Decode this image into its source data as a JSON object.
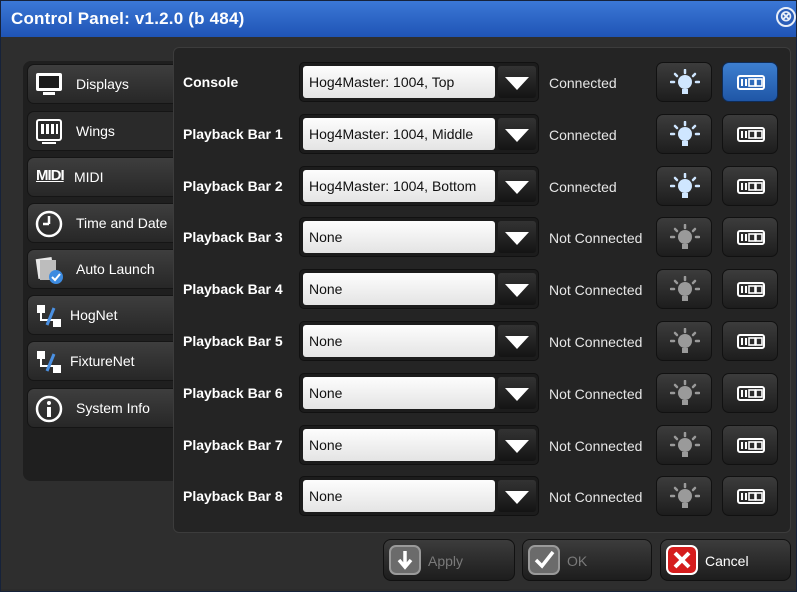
{
  "window": {
    "title": "Control Panel: v1.2.0 (b 484)",
    "close_glyph": "⊗"
  },
  "sidebar": {
    "items": [
      {
        "label": "Displays",
        "icon": "monitor-icon"
      },
      {
        "label": "Wings",
        "icon": "wing-icon"
      },
      {
        "label": "MIDI",
        "icon": "midi-icon"
      },
      {
        "label": "Time and Date",
        "icon": "clock-icon"
      },
      {
        "label": "Auto Launch",
        "icon": "auto-launch-icon"
      },
      {
        "label": "HogNet",
        "icon": "network-icon"
      },
      {
        "label": "FixtureNet",
        "icon": "network-icon"
      },
      {
        "label": "System Info",
        "icon": "info-icon"
      }
    ],
    "active": "Wings",
    "midi_logo": "MIDI"
  },
  "rows": [
    {
      "label": "Console",
      "value": "Hog4Master: 1004, Top",
      "status": "Connected",
      "bulb_on": true,
      "wing_selected": true
    },
    {
      "label": "Playback Bar 1",
      "value": "Hog4Master: 1004, Middle",
      "status": "Connected",
      "bulb_on": true,
      "wing_selected": false
    },
    {
      "label": "Playback Bar 2",
      "value": "Hog4Master: 1004, Bottom",
      "status": "Connected",
      "bulb_on": true,
      "wing_selected": false
    },
    {
      "label": "Playback Bar 3",
      "value": "None",
      "status": "Not Connected",
      "bulb_on": false,
      "wing_selected": false
    },
    {
      "label": "Playback Bar 4",
      "value": "None",
      "status": "Not Connected",
      "bulb_on": false,
      "wing_selected": false
    },
    {
      "label": "Playback Bar 5",
      "value": "None",
      "status": "Not Connected",
      "bulb_on": false,
      "wing_selected": false
    },
    {
      "label": "Playback Bar 6",
      "value": "None",
      "status": "Not Connected",
      "bulb_on": false,
      "wing_selected": false
    },
    {
      "label": "Playback Bar 7",
      "value": "None",
      "status": "Not Connected",
      "bulb_on": false,
      "wing_selected": false
    },
    {
      "label": "Playback Bar 8",
      "value": "None",
      "status": "Not Connected",
      "bulb_on": false,
      "wing_selected": false
    }
  ],
  "footer": {
    "apply_label": "Apply",
    "ok_label": "OK",
    "cancel_label": "Cancel"
  },
  "colors": {
    "titlebar": "#2a64c8",
    "accent_blue": "#2f6dc4",
    "bulb_on": "#cfe6ff",
    "bulb_off": "#9a9a9a",
    "cancel_red": "#d51d1d"
  }
}
